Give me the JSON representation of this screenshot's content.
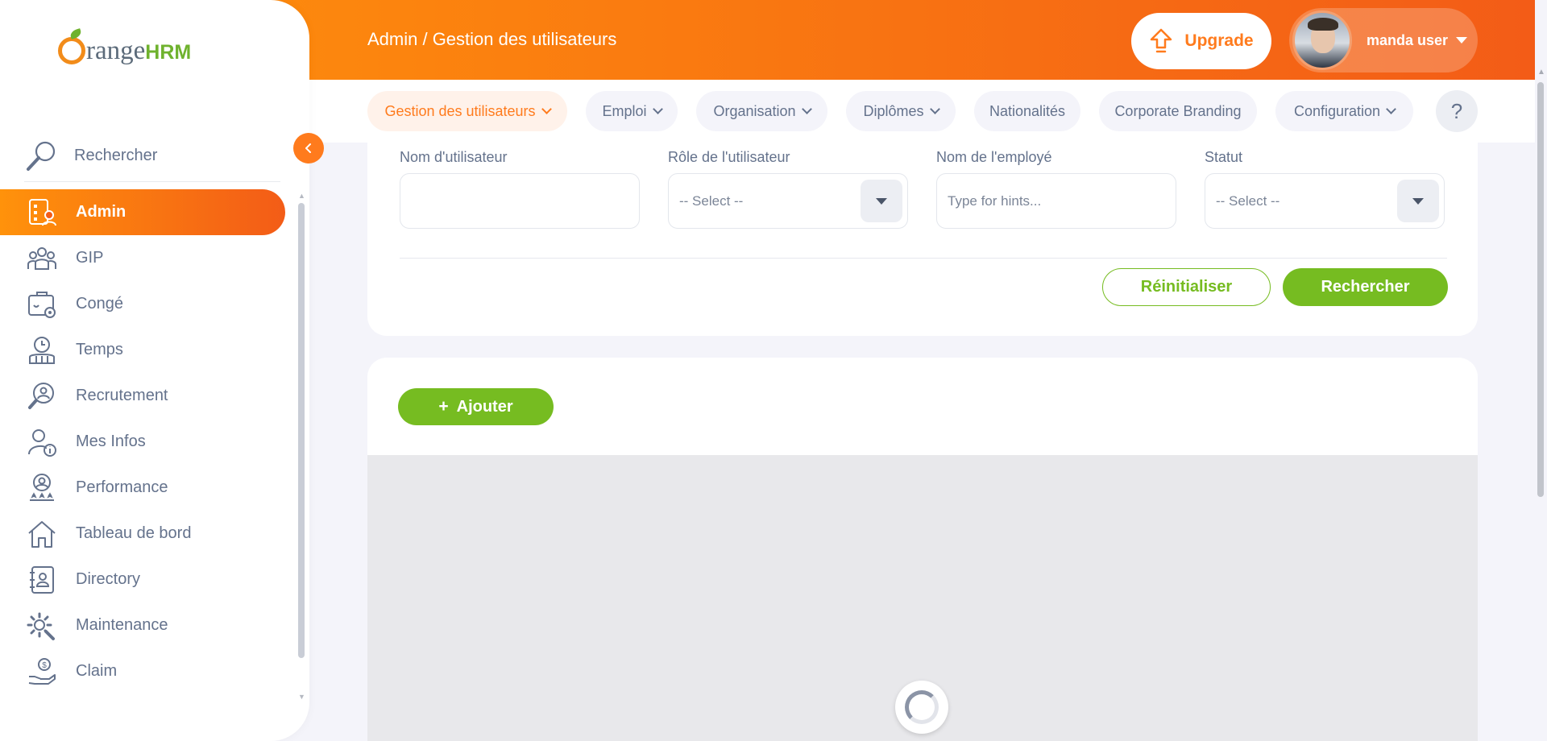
{
  "app": {
    "logo_text": "range",
    "logo_hrm": "HRM"
  },
  "sidebar": {
    "search_label": "Rechercher",
    "items": [
      {
        "label": "Admin",
        "icon": "admin-icon",
        "active": true
      },
      {
        "label": "GIP",
        "icon": "people-icon"
      },
      {
        "label": "Congé",
        "icon": "leave-icon"
      },
      {
        "label": "Temps",
        "icon": "clock-icon"
      },
      {
        "label": "Recrutement",
        "icon": "recruitment-icon"
      },
      {
        "label": "Mes Infos",
        "icon": "info-user-icon"
      },
      {
        "label": "Performance",
        "icon": "performance-icon"
      },
      {
        "label": "Tableau de bord",
        "icon": "home-icon"
      },
      {
        "label": "Directory",
        "icon": "directory-icon"
      },
      {
        "label": "Maintenance",
        "icon": "gear-wrench-icon"
      },
      {
        "label": "Claim",
        "icon": "claim-icon"
      }
    ]
  },
  "header": {
    "breadcrumb": "Admin / Gestion des utilisateurs",
    "upgrade_label": "Upgrade",
    "user_name": "manda user"
  },
  "tabs": [
    {
      "label": "Gestion des utilisateurs",
      "dropdown": true,
      "active": true
    },
    {
      "label": "Emploi",
      "dropdown": true
    },
    {
      "label": "Organisation",
      "dropdown": true
    },
    {
      "label": "Diplômes",
      "dropdown": true
    },
    {
      "label": "Nationalités",
      "dropdown": false
    },
    {
      "label": "Corporate Branding",
      "dropdown": false
    },
    {
      "label": "Configuration",
      "dropdown": true
    }
  ],
  "help_label": "?",
  "filters": {
    "username_label": "Nom d'utilisateur",
    "username_value": "",
    "role_label": "Rôle de l'utilisateur",
    "role_value": "-- Select --",
    "employee_label": "Nom de l'employé",
    "employee_placeholder": "Type for hints...",
    "status_label": "Statut",
    "status_value": "-- Select --",
    "reset_label": "Réinitialiser",
    "search_label": "Rechercher"
  },
  "results": {
    "add_label": "Ajouter",
    "add_icon": "+"
  },
  "colors": {
    "accent": "#ff7b1d",
    "green": "#76bc21",
    "topbar_start": "#ff920b",
    "topbar_end": "#f35c17"
  }
}
